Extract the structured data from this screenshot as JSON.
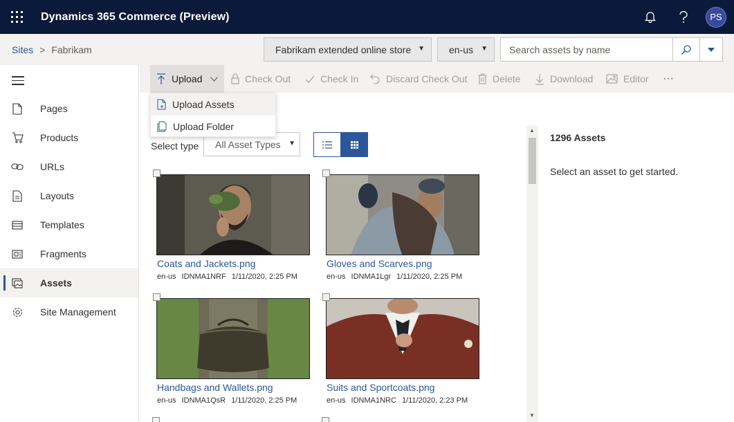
{
  "app": {
    "title": "Dynamics 365 Commerce (Preview)",
    "avatar_initials": "PS"
  },
  "icons": {
    "waffle": "waffle-icon",
    "bell": "bell-icon",
    "help": "question-icon",
    "search": "search-icon"
  },
  "breadcrumb": {
    "root": "Sites",
    "sep": ">",
    "current": "Fabrikam"
  },
  "site_select": {
    "value": "Fabrikam extended online store"
  },
  "locale_select": {
    "value": "en-us"
  },
  "search": {
    "placeholder": "Search assets by name"
  },
  "nav": {
    "items": [
      {
        "label": "Pages",
        "icon": "page-icon"
      },
      {
        "label": "Products",
        "icon": "cart-icon"
      },
      {
        "label": "URLs",
        "icon": "link-icon"
      },
      {
        "label": "Layouts",
        "icon": "layout-icon"
      },
      {
        "label": "Templates",
        "icon": "template-icon"
      },
      {
        "label": "Fragments",
        "icon": "fragment-icon"
      },
      {
        "label": "Assets",
        "icon": "assets-icon",
        "active": true
      },
      {
        "label": "Site Management",
        "icon": "gear-icon"
      }
    ]
  },
  "commands": {
    "upload": "Upload",
    "check_out": "Check Out",
    "check_in": "Check In",
    "discard": "Discard Check Out",
    "delete": "Delete",
    "download": "Download",
    "editor": "Editor",
    "more": "···"
  },
  "upload_menu": {
    "items": [
      "Upload Assets",
      "Upload Folder"
    ]
  },
  "filter": {
    "label": "Select type",
    "value": "All Asset Types"
  },
  "assets": [
    {
      "name": "Coats and Jackets.png",
      "locale": "en-us",
      "id": "IDNMA1NRF",
      "date": "1/11/2020, 2:25 PM"
    },
    {
      "name": "Gloves and Scarves.png",
      "locale": "en-us",
      "id": "IDNMA1Lgr",
      "date": "1/11/2020, 2:25 PM"
    },
    {
      "name": "Handbags and Wallets.png",
      "locale": "en-us",
      "id": "IDNMA1QsR",
      "date": "1/11/2020, 2:25 PM"
    },
    {
      "name": "Suits and Sportcoats.png",
      "locale": "en-us",
      "id": "IDNMA1NRC",
      "date": "1/11/2020, 2:23 PM"
    }
  ],
  "details": {
    "count": "1296 Assets",
    "hint": "Select an asset to get started."
  },
  "colors": {
    "topbar": "#0b1a3a",
    "accent": "#2b579a",
    "avatar": "#3a4a9b"
  }
}
